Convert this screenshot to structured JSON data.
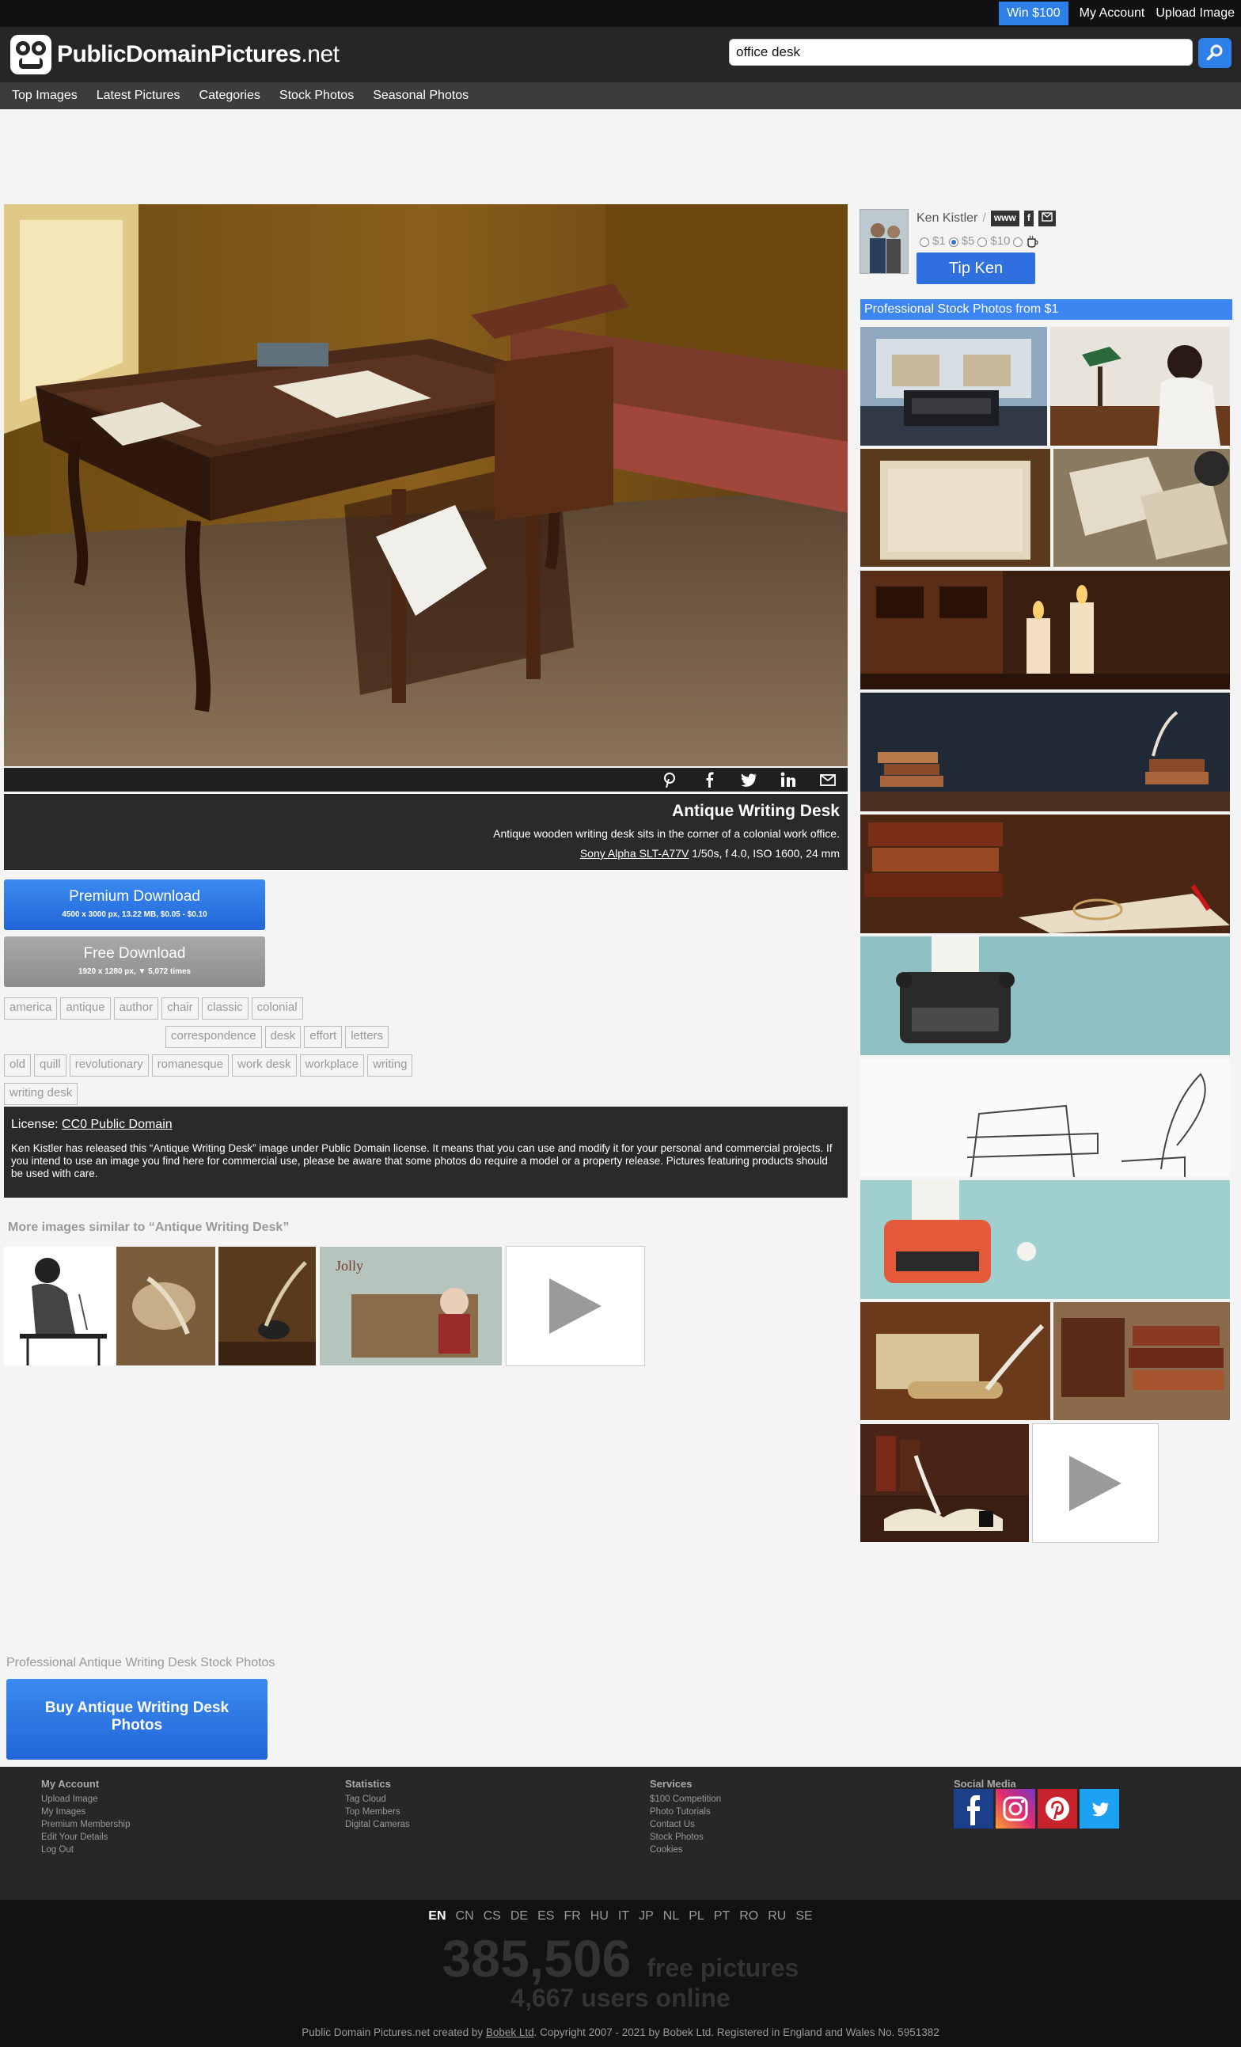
{
  "topbar": {
    "win": "Win $100",
    "account": "My Account",
    "upload": "Upload Image"
  },
  "header": {
    "logo_bold": "PublicDomainPictures",
    "logo_tld": ".net",
    "search_value": "office desk"
  },
  "nav": [
    "Top Images",
    "Latest Pictures",
    "Categories",
    "Stock Photos",
    "Seasonal Photos"
  ],
  "image": {
    "title": "Antique Writing Desk",
    "description": "Antique wooden writing desk sits in the corner of a colonial work office.",
    "camera": "Sony Alpha SLT-A77V",
    "exif": " 1/50s, f 4.0, ISO 1600, 24 mm"
  },
  "downloads": {
    "premium_label": "Premium Download",
    "premium_info": "4500 x 3000 px, 13.22 MB, $0.05 - $0.10",
    "free_label": "Free Download",
    "free_info": "1920 x 1280 px, ▼ 5,072 times"
  },
  "tags": [
    "america",
    "antique",
    "author",
    "chair",
    "classic",
    "colonial",
    "correspondence",
    "desk",
    "effort",
    "letters",
    "old",
    "quill",
    "revolutionary",
    "romanesque",
    "work desk",
    "workplace",
    "writing",
    "writing desk"
  ],
  "license": {
    "prefix": "License: ",
    "name": "CC0 Public Domain",
    "text": "Ken Kistler has released this “Antique Writing Desk” image under Public Domain license. It means that you can use and modify it for your personal and commercial projects. If you intend to use an image you find here for commercial use, please be aware that some photos do require a model or a property release. Pictures featuring products should be used with care."
  },
  "similar_title": "More images similar to “Antique Writing Desk”",
  "author": {
    "name": "Ken Kistler",
    "sep": " /",
    "www": "www",
    "fb": "f",
    "tips": [
      {
        "label": "$1",
        "selected": false
      },
      {
        "label": "$5",
        "selected": true
      },
      {
        "label": "$10",
        "selected": false
      }
    ],
    "tip_button": "Tip Ken"
  },
  "stock_header": "Professional Stock Photos from $1",
  "bottom_cta": {
    "label": "Professional Antique Writing Desk Stock Photos",
    "button": "Buy Antique Writing Desk Photos"
  },
  "footer": {
    "account": {
      "title": "My Account",
      "items": [
        "Upload Image",
        "My Images",
        "Premium Membership",
        "Edit Your Details",
        "Log Out"
      ]
    },
    "stats": {
      "title": "Statistics",
      "items": [
        "Tag Cloud",
        "Top Members",
        "Digital Cameras"
      ]
    },
    "services": {
      "title": "Services",
      "items": [
        "$100 Competition",
        "Photo Tutorials",
        "Contact Us",
        "Stock Photos",
        "Cookies"
      ]
    },
    "social_title": "Social Media"
  },
  "languages": [
    "EN",
    "CN",
    "CS",
    "DE",
    "ES",
    "FR",
    "HU",
    "IT",
    "JP",
    "NL",
    "PL",
    "PT",
    "RO",
    "RU",
    "SE"
  ],
  "stats": {
    "count": "385,506",
    "count_label": "free pictures",
    "users": "4,667 users online"
  },
  "copyright": {
    "pre": "Public Domain Pictures.net created by ",
    "company": "Bobek Ltd",
    "post": ". Copyright 2007 - 2021 by Bobek Ltd. Registered in England and Wales No. 5951382"
  },
  "colors": {
    "accent": "#2f7fe8",
    "dark": "#262626",
    "background": "#f4f4f4"
  }
}
